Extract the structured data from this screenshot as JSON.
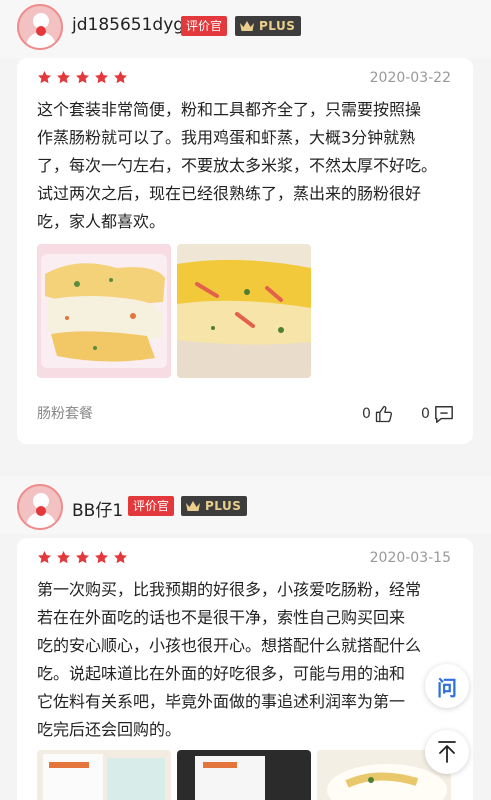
{
  "reviews": [
    {
      "username": "jd185651dyg",
      "badge_eval": "评价官",
      "badge_plus": "PLUS",
      "rating": 5,
      "date": "2020-03-22",
      "text": "这个套装非常简便，粉和工具都齐全了，只需要按照操作蒸肠粉就可以了。我用鸡蛋和虾蒸，大概3分钟就熟了，每次一勺左右，不要放太多米浆，不然太厚不好吃。试过两次之后，现在已经很熟练了，蒸出来的肠粉很好吃，家人都喜欢。",
      "lines": [
        "这个套装非常简便，粉和工具都齐全了，只需要按照操",
        "作蒸肠粉就可以了。我用鸡蛋和虾蒸，大概3分钟就熟",
        "了，每次一勺左右，不要放太多米浆，不然太厚不好吃。",
        "试过两次之后，现在已经很熟练了，蒸出来的肠粉很好",
        "吃，家人都喜欢。"
      ],
      "product_tag": "肠粉套餐",
      "like_count": "0",
      "comment_count": "0"
    },
    {
      "username": "BB仔1",
      "badge_eval": "评价官",
      "badge_plus": "PLUS",
      "rating": 5,
      "date": "2020-03-15",
      "text": "第一次购买，比我预期的好很多，小孩爱吃肠粉，经常若在在外面吃的话也不是很干净，索性自己购买回来吃的安心顺心，小孩也很开心。想搭配什么就搭配什么吃。说起味道比在外面的好吃很多，可能与用的油和它佐料有关系吧，毕竟外面做的事追述利润率为第一吃完后还会回购的。",
      "lines": [
        "第一次购买，比我预期的好很多，小孩爱吃肠粉，经常",
        "若在在外面吃的话也不是很干净，索性自己购买回来",
        "吃的安心顺心，小孩也很开心。想搭配什么就搭配什么",
        "吃。说起味道比在外面的好吃很多，可能与用的油和",
        "它佐料有关系吧，毕竟外面做的事追述利润率为第一",
        "吃完后还会回购的。"
      ]
    }
  ],
  "float_buttons": {
    "ask_label": "问"
  },
  "colors": {
    "accent": "#e4393c",
    "plus_bg": "#3d3d3d",
    "plus_text": "#e9cf8b"
  }
}
